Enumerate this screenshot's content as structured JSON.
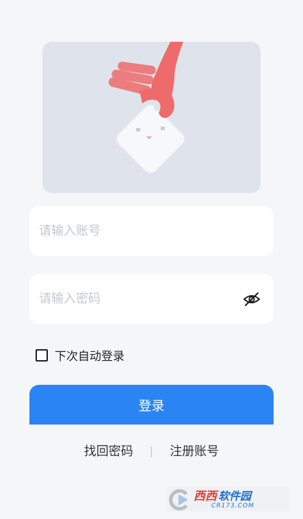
{
  "login_form": {
    "account_placeholder": "请输入账号",
    "password_placeholder": "请输入密码",
    "password_visibility_icon": "eye-slash-icon",
    "remember_label": "下次自动登录",
    "remember_checked": false,
    "login_label": "登录"
  },
  "footer_links": {
    "find_password": "找回密码",
    "separator": "|",
    "register": "注册账号"
  },
  "watermark": {
    "brand_red": "西西",
    "brand_blue": "软件园",
    "url": "CR173.COM"
  },
  "colors": {
    "background": "#f5f6f8",
    "primary": "#2b84f4",
    "hero_bg": "#dfe4ec",
    "hand": "#ef6b6b"
  }
}
